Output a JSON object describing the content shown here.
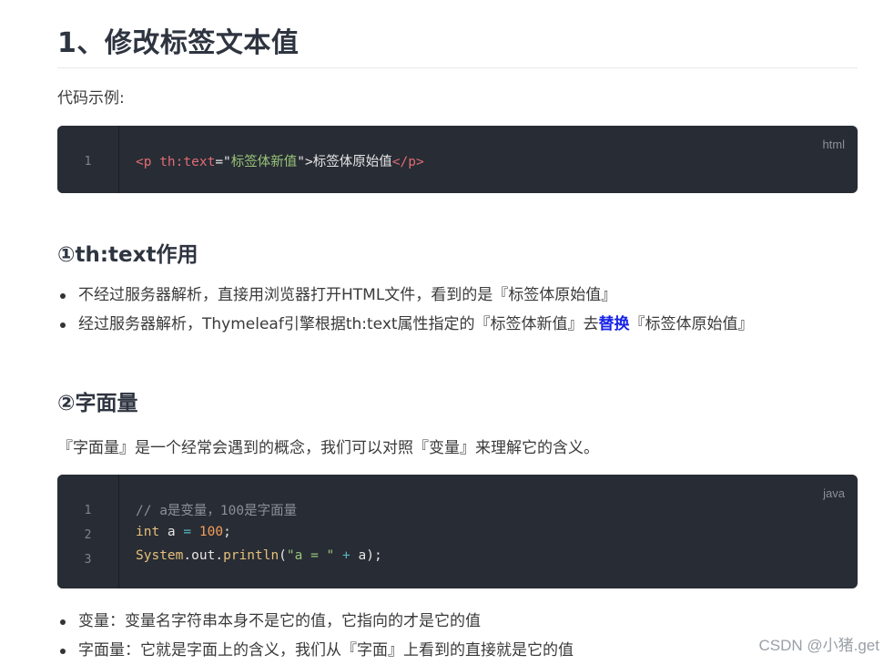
{
  "heading": "1、修改标签文本值",
  "intro": "代码示例:",
  "code1": {
    "lang": "html",
    "line_numbers": [
      "1"
    ],
    "tokens": {
      "lt_p": "<p ",
      "attr": "th:text",
      "eq": "=\"",
      "val": "标签体新值",
      "q_gt": "\">",
      "content": "标签体原始值",
      "close": "</p>"
    }
  },
  "section1": {
    "title": "①th:text作用",
    "bullets": [
      "不经过服务器解析，直接用浏览器打开HTML文件，看到的是『标签体原始值』"
    ],
    "bullet2": {
      "prefix": "经过服务器解析，Thymeleaf引擎根据th:text属性指定的『标签体新值』去",
      "strong": "替换",
      "suffix": "『标签体原始值』"
    }
  },
  "section2": {
    "title": "②字面量",
    "text": "『字面量』是一个经常会遇到的概念，我们可以对照『变量』来理解它的含义。"
  },
  "code2": {
    "lang": "java",
    "line_numbers": [
      "1",
      "2",
      "3"
    ],
    "line1": "// a是变量，100是字面量",
    "line2": {
      "kw": "int",
      "var": " a ",
      "op": "=",
      "num": " 100",
      "end": ";"
    },
    "line3": {
      "cls": "System",
      "dot1": ".",
      "field": "out",
      "dot2": ".",
      "method": "println",
      "open": "(",
      "str": "\"a = \"",
      "op": " + ",
      "rest": "a);"
    }
  },
  "bullets2": [
    "变量：变量名字符串本身不是它的值，它指向的才是它的值",
    "字面量：它就是字面上的含义，我们从『字面』上看到的直接就是它的值"
  ],
  "watermark": "CSDN @小猪.get"
}
